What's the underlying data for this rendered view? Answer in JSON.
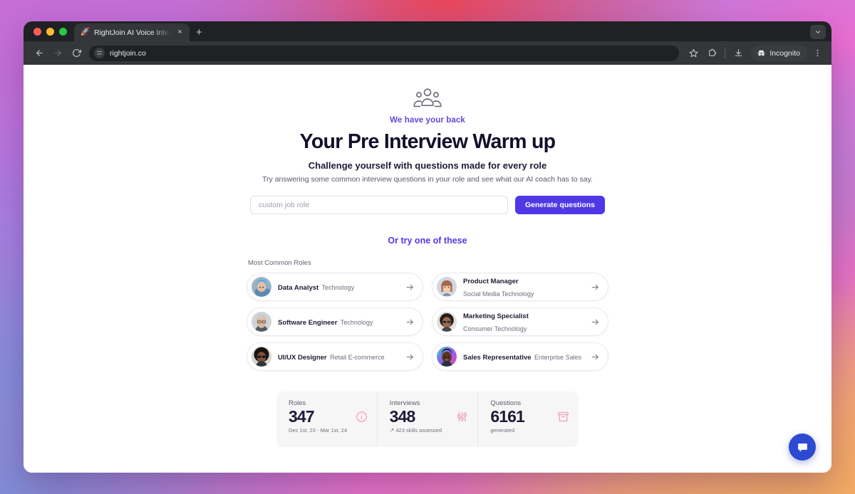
{
  "browser": {
    "tab": {
      "title": "RightJoin AI Voice Interviews",
      "favicon_name": "rocket-icon",
      "close_label": "×"
    },
    "new_tab_label": "+",
    "toolbar": {
      "back_label": "←",
      "forward_label": "→",
      "reload_label": "↻",
      "url": "rightjoin.co",
      "site_settings_icon": "tune-icon",
      "bookmark_icon": "star-icon",
      "extensions_icon": "extensions-icon",
      "download_icon": "download-icon",
      "incognito_label": "Incognito",
      "incognito_icon": "incognito-hat-icon",
      "menu_icon": "three-dot-menu-icon"
    },
    "tab_list_icon": "chevron-down-icon"
  },
  "hero": {
    "icon_name": "users-group-icon",
    "eyebrow": "We have your back",
    "title": "Your Pre Interview Warm up",
    "subtitle": "Challenge yourself with questions made for every role",
    "lede": "Try answering some common interview questions in your role and see what our AI coach has to say."
  },
  "form": {
    "input_value": "",
    "input_placeholder": "custom job role",
    "generate_label": "Generate questions"
  },
  "or_try": "Or try one of these",
  "roles": {
    "section_label": "Most Common Roles",
    "items": [
      {
        "title": "Data Analyst",
        "industry": "Technology",
        "avatar_name": "avatar-data-analyst",
        "arrow": "→"
      },
      {
        "title": "Product Manager",
        "industry": "Social Media Technology",
        "avatar_name": "avatar-product-manager",
        "arrow": "→"
      },
      {
        "title": "Software Engineer",
        "industry": "Technology",
        "avatar_name": "avatar-software-engineer",
        "arrow": "→"
      },
      {
        "title": "Marketing Specialist",
        "industry": "Consumer Technology",
        "avatar_name": "avatar-marketing-specialist",
        "arrow": "→"
      },
      {
        "title": "UI/UX Designer",
        "industry": "Retail E-commerce",
        "avatar_name": "avatar-uiux-designer",
        "arrow": "→"
      },
      {
        "title": "Sales Representative",
        "industry": "Enterprise Sales",
        "avatar_name": "avatar-sales-representative",
        "arrow": "→"
      }
    ]
  },
  "stats": [
    {
      "label": "Roles",
      "value": "347",
      "footnote": "Dec 1st, 23 - Mar 1st, 24",
      "trend": "",
      "icon_name": "info-circle-icon"
    },
    {
      "label": "Interviews",
      "value": "348",
      "footnote": "423 skills assessed",
      "trend": "↗",
      "icon_name": "sliders-icon"
    },
    {
      "label": "Questions",
      "value": "6161",
      "footnote": "generated",
      "trend": "",
      "icon_name": "archive-box-icon"
    }
  ],
  "chat_widget": {
    "icon_name": "chat-bubble-icon"
  },
  "colors": {
    "accent_purple": "#4f39e6",
    "stat_icon_pink": "#f0a0bd",
    "heading_dark": "#12102b",
    "chat_blue": "#2b4ad1"
  }
}
